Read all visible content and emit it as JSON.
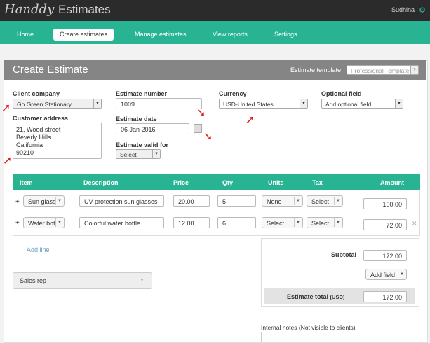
{
  "app": {
    "brand_script": "Handdy",
    "brand_word": "Estimates",
    "user": "Sudhina"
  },
  "nav": {
    "home": "Home",
    "create": "Create estimates",
    "manage": "Manage estimates",
    "reports": "View reports",
    "settings": "Settings"
  },
  "page": {
    "title": "Create Estimate",
    "template_label": "Estimate template",
    "template_value": "Professional Template"
  },
  "form": {
    "client_company_label": "Client company",
    "client_company_value": "Go Green Stationary",
    "customer_address_label": "Customer address",
    "address_lines": [
      "21, Wood street",
      "Beverly Hills",
      "California",
      "90210"
    ],
    "estimate_number_label": "Estimate number",
    "estimate_number_value": "1009",
    "estimate_date_label": "Estimate date",
    "estimate_date_value": "06 Jan 2016",
    "valid_for_label": "Estimate valid for",
    "valid_for_value": "Select",
    "currency_label": "Currency",
    "currency_value": "USD-United States",
    "optional_label": "Optional field",
    "optional_value": "Add optional field"
  },
  "table": {
    "headers": {
      "item": "Item",
      "description": "Description",
      "price": "Price",
      "qty": "Qty",
      "units": "Units",
      "tax": "Tax",
      "amount": "Amount"
    },
    "rows": [
      {
        "item": "Sun glass",
        "description": "UV protection sun glasses",
        "price": "20.00",
        "qty": "5",
        "units": "None",
        "tax": "Select",
        "amount": "100.00"
      },
      {
        "item": "Water bot",
        "description": "Colorful water bottle",
        "price": "12.00",
        "qty": "6",
        "units": "Select",
        "tax": "Select",
        "amount": "72.00"
      }
    ],
    "add_line": "Add line"
  },
  "sales_rep": "Sales rep",
  "summary": {
    "subtotal_label": "Subtotal",
    "subtotal_value": "172.00",
    "add_field": "Add field",
    "total_label": "Estimate total",
    "total_currency": "(USD)",
    "total_value": "172.00"
  },
  "notes_label": "Internal notes (Not visible to clients)",
  "colors": {
    "accent": "#28b493",
    "header_bar": "#858585",
    "topbar": "#2b2b2b",
    "arrow": "#e0201c"
  }
}
